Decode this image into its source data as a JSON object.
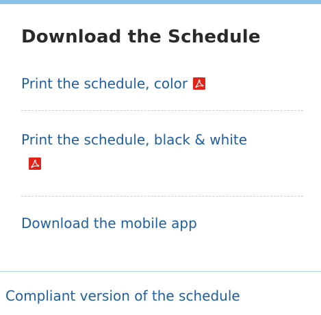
{
  "panel": {
    "heading": "Download the Schedule",
    "accent_color": "#8ec2e8",
    "link_color": "#1f5fa0",
    "links": [
      {
        "label": "Print the schedule, color",
        "icon": "pdf-icon"
      },
      {
        "label": "Print the schedule, black & white",
        "icon": "pdf-icon"
      },
      {
        "label": "Download the mobile app"
      }
    ]
  },
  "footer": {
    "compliant_label": "Compliant version of the schedule"
  }
}
